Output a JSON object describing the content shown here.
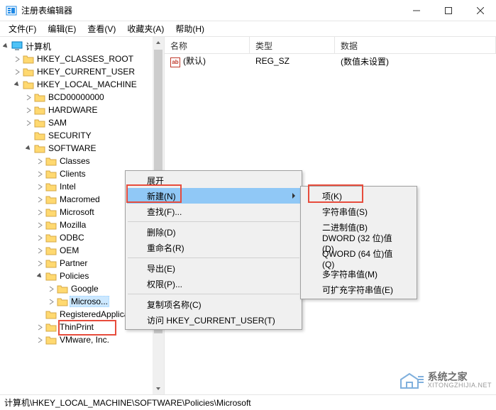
{
  "window": {
    "title": "注册表编辑器"
  },
  "menubar": {
    "file": "文件(F)",
    "edit": "编辑(E)",
    "view": "查看(V)",
    "favorites": "收藏夹(A)",
    "help": "帮助(H)"
  },
  "tree": {
    "root": "计算机",
    "hkcr": "HKEY_CLASSES_ROOT",
    "hkcu": "HKEY_CURRENT_USER",
    "hklm": "HKEY_LOCAL_MACHINE",
    "bcd": "BCD00000000",
    "hardware": "HARDWARE",
    "sam": "SAM",
    "security": "SECURITY",
    "software": "SOFTWARE",
    "classes": "Classes",
    "clients": "Clients",
    "intel": "Intel",
    "macromed": "Macromed",
    "microsoft": "Microsoft",
    "mozilla": "Mozilla",
    "odbc": "ODBC",
    "oem": "OEM",
    "partner": "Partner",
    "policies": "Policies",
    "google": "Google",
    "policies_microsoft": "Microso...",
    "registeredapp": "RegisteredApplica...",
    "thinprint": "ThinPrint",
    "vmware": "VMware, Inc."
  },
  "list": {
    "header": {
      "name": "名称",
      "type": "类型",
      "data": "数据"
    },
    "rows": [
      {
        "icon": "ab",
        "name": "(默认)",
        "type": "REG_SZ",
        "data": "(数值未设置)"
      }
    ]
  },
  "context_menu": {
    "expand": "展开",
    "new": "新建(N)",
    "find": "查找(F)...",
    "delete": "删除(D)",
    "rename": "重命名(R)",
    "export": "导出(E)",
    "permissions": "权限(P)...",
    "copy_key_name": "复制项名称(C)",
    "goto_hkcu": "访问 HKEY_CURRENT_USER(T)"
  },
  "submenu": {
    "key": "项(K)",
    "string": "字符串值(S)",
    "binary": "二进制值(B)",
    "dword": "DWORD (32 位)值(D)",
    "qword": "QWORD (64 位)值(Q)",
    "multistring": "多字符串值(M)",
    "expandstring": "可扩充字符串值(E)"
  },
  "statusbar": {
    "path": "计算机\\HKEY_LOCAL_MACHINE\\SOFTWARE\\Policies\\Microsoft"
  },
  "watermark": {
    "cn": "系统之家",
    "en": "XITONGZHIJIA.NET"
  }
}
